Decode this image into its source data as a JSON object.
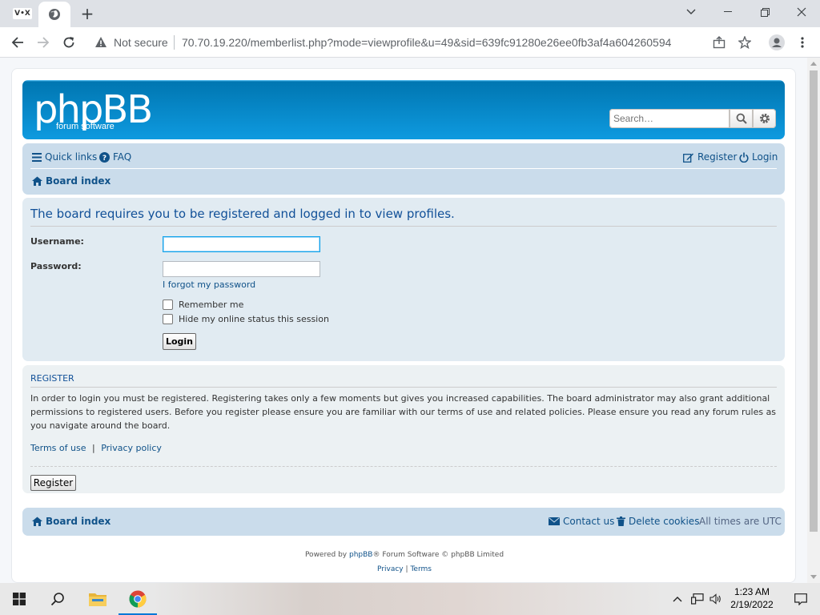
{
  "browser": {
    "tab_badge": "V•X",
    "new_tab_symbol": "+",
    "omnibox": {
      "security_label": "Not secure",
      "url": "70.70.19.220/memberlist.php?mode=viewprofile&u=49&sid=639fc91280e26ee0fb3af4a604260594"
    }
  },
  "header": {
    "logo_main": "phpBB",
    "logo_sub": "forum  software",
    "search_placeholder": "Search…"
  },
  "nav": {
    "quick_links": "Quick links",
    "faq": "FAQ",
    "register": "Register",
    "login": "Login",
    "board_index": "Board index"
  },
  "login_panel": {
    "message": "The board requires you to be registered and logged in to view profiles.",
    "username_label": "Username:",
    "password_label": "Password:",
    "forgot_link": "I forgot my password",
    "remember_me": "Remember me",
    "hide_status": "Hide my online status this session",
    "login_button": "Login"
  },
  "register_panel": {
    "title": "REGISTER",
    "body": "In order to login you must be registered. Registering takes only a few moments but gives you increased capabilities. The board administrator may also grant additional permissions to registered users. Before you register please ensure you are familiar with our terms of use and related policies. Please ensure you read any forum rules as you navigate around the board.",
    "terms_link": "Terms of use",
    "link_separator": "|",
    "privacy_link": "Privacy policy",
    "register_button": "Register"
  },
  "footer_nav": {
    "board_index": "Board index",
    "contact": "Contact us",
    "delete_cookies": "Delete cookies",
    "timezone": "All times are UTC"
  },
  "copyright": {
    "powered_prefix": "Powered by",
    "phpbb_link": "phpBB",
    "powered_suffix": "® Forum Software © phpBB Limited",
    "privacy": "Privacy",
    "separator": "|",
    "terms": "Terms"
  },
  "taskbar": {
    "time": "1:23 AM",
    "date": "2/19/2022"
  },
  "colors": {
    "header_blue": "#12a3eb",
    "link_blue": "#105289",
    "nav_bg": "#cadceb",
    "panel_bg": "#e1ebf2"
  }
}
